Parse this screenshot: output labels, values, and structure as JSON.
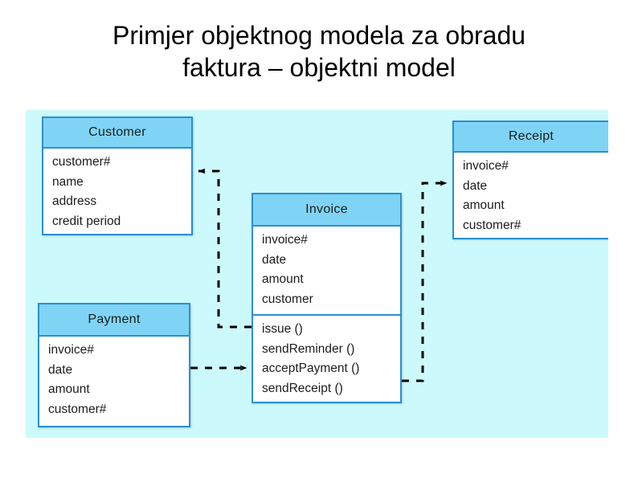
{
  "slide": {
    "title_line1": "Primjer objektnog modela za obradu",
    "title_line2": "faktura – objektni model"
  },
  "theme": {
    "canvas_background": "#ccfafc",
    "box_fill": "#ffffff",
    "header_fill": "#7fd4f5",
    "border": "#2b8fd4",
    "text": "#1c1c1c",
    "connector": "#000000",
    "page_background": "#ffffff"
  },
  "diagram": {
    "type": "uml-class-diagram",
    "classes": [
      {
        "id": "customer",
        "name": "Customer",
        "attributes": [
          "customer#",
          "name",
          "address",
          "credit period"
        ],
        "operations": []
      },
      {
        "id": "receipt",
        "name": "Receipt",
        "attributes": [
          "invoice#",
          "date",
          "amount",
          "customer#"
        ],
        "operations": []
      },
      {
        "id": "invoice",
        "name": "Invoice",
        "attributes": [
          "invoice#",
          "date",
          "amount",
          "customer"
        ],
        "operations": [
          "issue ()",
          "sendReminder ()",
          "acceptPayment ()",
          "sendReceipt ()"
        ]
      },
      {
        "id": "payment",
        "name": "Payment",
        "attributes": [
          "invoice#",
          "date",
          "amount",
          "customer#"
        ],
        "operations": []
      }
    ],
    "connectors": [
      {
        "id": "invoice-to-customer",
        "from": "invoice",
        "to": "customer",
        "style": "dashed",
        "arrow": "open"
      },
      {
        "id": "invoice-to-receipt",
        "from": "invoice",
        "to": "receipt",
        "style": "dashed",
        "arrow": "open"
      },
      {
        "id": "payment-to-invoice",
        "from": "payment",
        "to": "invoice",
        "style": "dashed",
        "arrow": "open"
      }
    ]
  }
}
